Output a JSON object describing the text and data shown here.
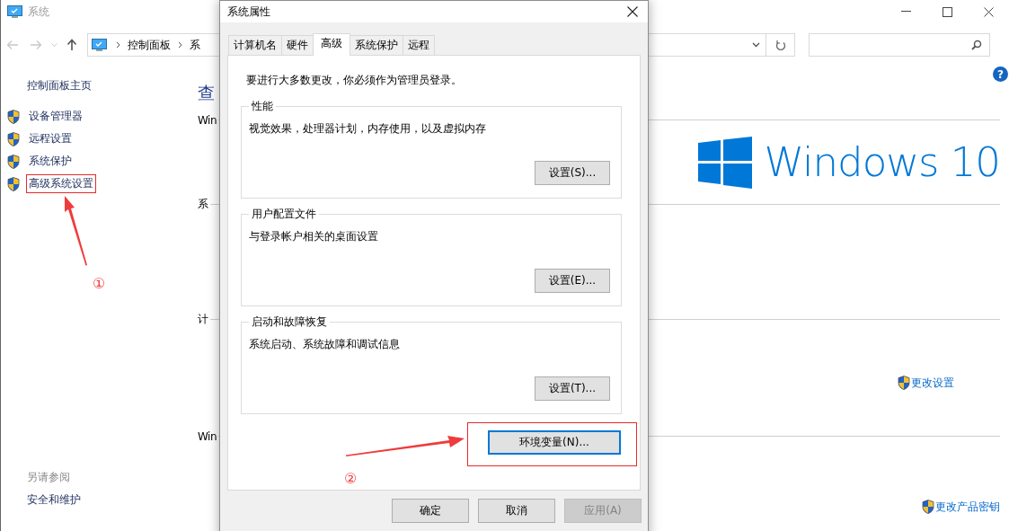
{
  "window": {
    "title": "系统"
  },
  "address_bar": {
    "breadcrumbs": [
      "控制面板",
      "系"
    ]
  },
  "sidebar": {
    "home": "控制面板主页",
    "items": [
      {
        "label": "设备管理器",
        "annotated": false
      },
      {
        "label": "远程设置",
        "annotated": false
      },
      {
        "label": "系统保护",
        "annotated": false
      },
      {
        "label": "高级系统设置",
        "annotated": true
      }
    ],
    "see_also": {
      "title": "另请参阅",
      "items": [
        "安全和维护"
      ]
    }
  },
  "main": {
    "title": "查",
    "help": "?",
    "sections": [
      {
        "heading": "Win",
        "logo_text": "Windows 10"
      },
      {
        "heading": "系"
      },
      {
        "heading": "计",
        "link": "更改设置"
      },
      {
        "heading": "Win",
        "link": "更改产品密钥"
      }
    ]
  },
  "dialog": {
    "title": "系统属性",
    "tabs": [
      {
        "label": "计算机名",
        "selected": false
      },
      {
        "label": "硬件",
        "selected": false
      },
      {
        "label": "高级",
        "selected": true
      },
      {
        "label": "系统保护",
        "selected": false
      },
      {
        "label": "远程",
        "selected": false
      }
    ],
    "notice": "要进行大多数更改，你必须作为管理员登录。",
    "groups": [
      {
        "title": "性能",
        "description": "视觉效果，处理器计划，内存使用，以及虚拟内存",
        "button": "设置(S)..."
      },
      {
        "title": "用户配置文件",
        "description": "与登录帐户相关的桌面设置",
        "button": "设置(E)..."
      },
      {
        "title": "启动和故障恢复",
        "description": "系统启动、系统故障和调试信息",
        "button": "设置(T)..."
      }
    ],
    "env_button": {
      "label": "环境变量(N)...",
      "annotated": true
    },
    "buttons": [
      {
        "label": "确定",
        "disabled": false
      },
      {
        "label": "取消",
        "disabled": false
      },
      {
        "label": "应用(A)",
        "disabled": true
      }
    ]
  },
  "annotations": [
    {
      "label": "①"
    },
    {
      "label": "②"
    }
  ]
}
